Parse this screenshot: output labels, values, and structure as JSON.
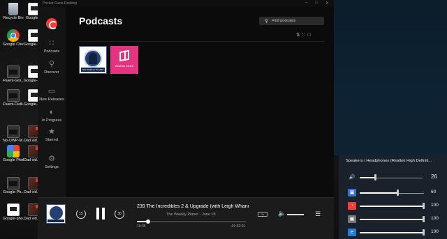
{
  "desktop": {
    "icons": [
      {
        "label": "Recycle Bin",
        "kind": "bin"
      },
      {
        "label": "Google-...",
        "kind": "doc"
      },
      {
        "label": "Google Chrome",
        "kind": "chrome"
      },
      {
        "label": "Google-I... - Copy",
        "kind": "doc"
      },
      {
        "label": "Fluent-Gro...",
        "kind": "dark"
      },
      {
        "label": "Google-g... - Copy",
        "kind": "doc"
      },
      {
        "label": "Fluent-Outli...",
        "kind": "dark"
      },
      {
        "label": "Google-g... - Copy",
        "kind": "doc"
      },
      {
        "label": "No-UWP-M...",
        "kind": "dark"
      },
      {
        "label": "Dad vid... test",
        "kind": "thumb"
      },
      {
        "label": "Google Photos",
        "kind": "photos"
      },
      {
        "label": "Dad vid... test 2",
        "kind": "thumb"
      },
      {
        "label": "Google-Ph...",
        "kind": "dark"
      },
      {
        "label": "Dad vid... test 3",
        "kind": "thumb"
      },
      {
        "label": "Google-pho...",
        "kind": "doc"
      },
      {
        "label": "Dad vid... test 4",
        "kind": "thumb"
      }
    ]
  },
  "app": {
    "window_title": "Pocket Casts Desktop",
    "page_title": "Podcasts",
    "search_placeholder": "Find podcasts",
    "nav": [
      {
        "label": "Podcasts",
        "icon": "grid-icon"
      },
      {
        "label": "Discover",
        "icon": "search-icon"
      },
      {
        "label": "New Releases",
        "icon": "new-releases-icon"
      },
      {
        "label": "In Progress",
        "icon": "in-progress-icon"
      },
      {
        "label": "Starred",
        "icon": "star-icon"
      },
      {
        "label": "Settings",
        "icon": "gear-icon"
      }
    ],
    "podcasts": [
      {
        "name": "The Weekly Planet",
        "art_text": "THE WEEKLY PLANET"
      },
      {
        "name": "Windows Central",
        "art_text": "Windows Central"
      }
    ]
  },
  "player": {
    "episode_title": "239 The Incredibles 2 & Upgrade (with Leigh Whann...",
    "episode_subtitle": "The Weekly Planet - June 18",
    "elapsed": "10:35",
    "remaining": "-01:32:01",
    "progress": 0.1,
    "skip_back": "15",
    "skip_forward": "30",
    "speed": "1x",
    "volume": 1.0
  },
  "mixer": {
    "device": "Speakers / Headphones (Realtek High Definiti...",
    "master": {
      "value": "26",
      "level": 0.26
    },
    "apps": [
      {
        "icon": "app-icon",
        "value": "60",
        "level": 0.6,
        "color": "#3a6fd8"
      },
      {
        "icon": "pocket-casts-icon",
        "value": "100",
        "level": 1.0,
        "color": "#f43e37"
      },
      {
        "icon": "app-icon",
        "value": "100",
        "level": 1.0,
        "color": "#777777"
      },
      {
        "icon": "edge-icon",
        "value": "100",
        "level": 1.0,
        "color": "#1e7fd6"
      }
    ]
  }
}
